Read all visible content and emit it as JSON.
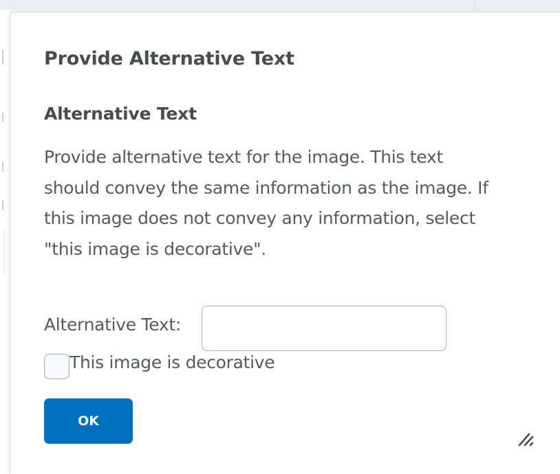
{
  "dialog": {
    "title": "Provide Alternative Text",
    "section_heading": "Alternative Text",
    "description_lines": [
      "Provide alternative text for the image. This text",
      "should convey the same information as the image. If",
      "this image does not convey any information, select",
      "\"this image is decorative\"."
    ],
    "alt_text_label": "Alternative Text:",
    "alt_text_value": "",
    "decorative_label": "This image is decorative",
    "decorative_checked": false,
    "ok_label": "OK"
  },
  "icons": {
    "resize": "resize-grip-icon"
  },
  "colors": {
    "primary_button": "#006fbf",
    "heading_text": "#494c4e",
    "body_text": "#565a5c",
    "input_border": "#a6abb0"
  }
}
